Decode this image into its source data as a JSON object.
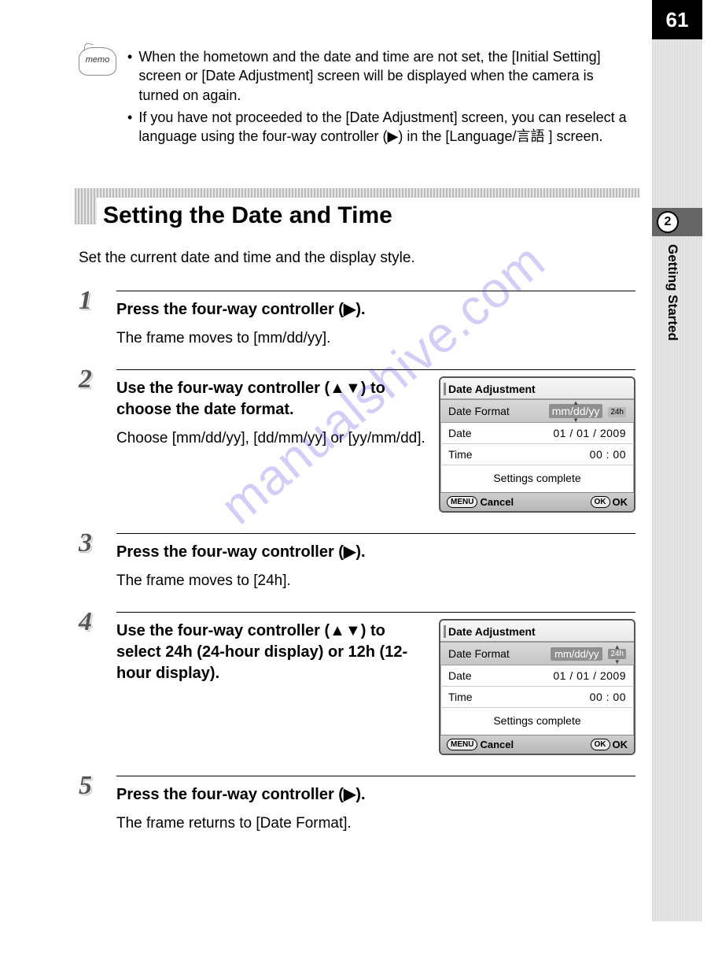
{
  "page_number": "61",
  "chapter": {
    "num": "2",
    "title": "Getting Started"
  },
  "memo": {
    "icon_label": "memo",
    "items": [
      "When the hometown and the date and time are not set, the [Initial Setting] screen or [Date Adjustment] screen will be displayed when the camera is turned on again.",
      "If you have not proceeded to the [Date Adjustment] screen, you can reselect a language using the four-way controller (▶) in the [Language/言語 ] screen."
    ]
  },
  "section_title": "Setting the Date and Time",
  "intro": "Set the current date and time and the display style.",
  "steps": [
    {
      "n": "1",
      "title": "Press the four-way controller (▶).",
      "desc": "The frame moves to [mm/dd/yy]."
    },
    {
      "n": "2",
      "title": "Use the four-way controller (▲▼) to choose the date format.",
      "desc": "Choose [mm/dd/yy], [dd/mm/yy] or [yy/mm/dd]."
    },
    {
      "n": "3",
      "title": "Press the four-way controller (▶).",
      "desc": "The frame moves to [24h]."
    },
    {
      "n": "4",
      "title": "Use the four-way controller (▲▼) to select 24h (24-hour display) or 12h (12-hour display).",
      "desc": ""
    },
    {
      "n": "5",
      "title": "Press the four-way controller (▶).",
      "desc": "The frame returns to [Date Format]."
    }
  ],
  "lcd": {
    "title": "Date Adjustment",
    "rows": {
      "format_label": "Date Format",
      "format_value": "mm/dd/yy",
      "hour_chip": "24h",
      "date_label": "Date",
      "date_value": "01 / 01 / 2009",
      "time_label": "Time",
      "time_value": "00 : 00",
      "complete": "Settings complete"
    },
    "foot": {
      "menu": "MENU",
      "cancel": "Cancel",
      "ok_btn": "OK",
      "ok": "OK"
    }
  },
  "watermark": "manualshive.com"
}
